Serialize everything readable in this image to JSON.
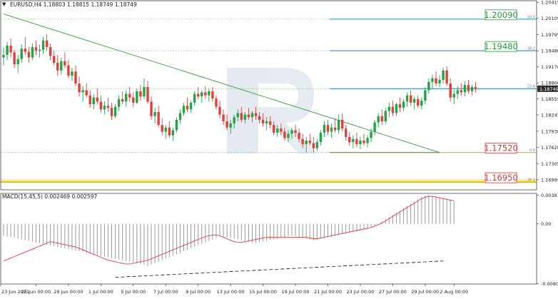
{
  "header": {
    "arrow": "▼",
    "main_label": "EURUSD,H4  1.18803 1.18815 1.18749 1.18749",
    "macd_label": "MACD(15,45,5) 0.002469 0.002597"
  },
  "colors": {
    "bull": "#22a447",
    "bear": "#e1403a",
    "trend": "#3c9a3c",
    "fibo": "#35a4b3",
    "fibo_low": "#e0c020",
    "grid": "#7fbf7f",
    "macd_hist": "#9a9a9a",
    "macd_signal": "#e04040",
    "price_tag_bg": "#2d2d2d"
  },
  "chart_data": [
    {
      "type": "candlestick",
      "title": "EURUSD,H4",
      "ohlc_header": "1.18803 1.18815 1.18749 1.18749",
      "x_ticks": [
        "23 Jun 2021",
        "25 Jun 00:00",
        "29 Jun 00:00",
        "1 Jul 00:00",
        "5 Jul 00:00",
        "7 Jul 00:00",
        "9 Jul 00:00",
        "13 Jul 00:00",
        "15 Jul 00:00",
        "19 Jul 00:00",
        "21 Jul 00:00",
        "23 Jul 00:00",
        "27 Jul 00:00",
        "29 Jul 00:00",
        "2 Aug 00:00"
      ],
      "y_ticks": [
        1.20415,
        1.20105,
        1.19795,
        1.1948,
        1.1917,
        1.1886,
        1.18555,
        1.18245,
        1.1793,
        1.1762,
        1.17305,
        1.16995
      ],
      "ylim": [
        1.168,
        1.20445
      ],
      "current_price": "1.18749",
      "current_price_value": 1.18749,
      "fibonacci_levels": [
        {
          "ratio": "50.0",
          "value": 1.2009,
          "label": "1.20090",
          "box": true,
          "color": "fibo"
        },
        {
          "ratio": "38.2",
          "value": 1.1948,
          "label": "1.19480",
          "box": true,
          "color": "fibo"
        },
        {
          "ratio": "23.6",
          "value": 1.1875,
          "label": "",
          "box": false,
          "color": "fibo"
        },
        {
          "ratio": "0.0",
          "value": 1.1752,
          "label": "1.17520",
          "box": true,
          "color": "fibo_low"
        },
        {
          "ratio": "38.2",
          "value": 1.1695,
          "label": "1.16950",
          "box": true,
          "color": "fibo_low"
        }
      ],
      "trendline": {
        "start": [
          0,
          1.2019
        ],
        "end": [
          121,
          1.1752
        ]
      },
      "candles": [
        [
          1.1935,
          1.1955,
          1.192,
          1.194
        ],
        [
          1.194,
          1.1965,
          1.193,
          1.1958
        ],
        [
          1.1958,
          1.1972,
          1.1935,
          1.1945
        ],
        [
          1.1945,
          1.195,
          1.1915,
          1.1922
        ],
        [
          1.1922,
          1.194,
          1.1905,
          1.1932
        ],
        [
          1.1932,
          1.196,
          1.1925,
          1.1952
        ],
        [
          1.1952,
          1.1975,
          1.194,
          1.1946
        ],
        [
          1.1946,
          1.1955,
          1.1925,
          1.1935
        ],
        [
          1.1935,
          1.1962,
          1.193,
          1.1955
        ],
        [
          1.1955,
          1.1968,
          1.194,
          1.1948
        ],
        [
          1.1948,
          1.196,
          1.1935,
          1.195
        ],
        [
          1.195,
          1.1975,
          1.1942,
          1.1968
        ],
        [
          1.1968,
          1.198,
          1.1948,
          1.1955
        ],
        [
          1.1955,
          1.1962,
          1.193,
          1.1938
        ],
        [
          1.1938,
          1.1948,
          1.192,
          1.1925
        ],
        [
          1.1925,
          1.194,
          1.19,
          1.191
        ],
        [
          1.191,
          1.1935,
          1.1902,
          1.1928
        ],
        [
          1.1928,
          1.1945,
          1.1915,
          1.192
        ],
        [
          1.192,
          1.193,
          1.1895,
          1.19
        ],
        [
          1.19,
          1.1915,
          1.189,
          1.1908
        ],
        [
          1.1908,
          1.192,
          1.188,
          1.1885
        ],
        [
          1.1885,
          1.1898,
          1.186,
          1.1868
        ],
        [
          1.1868,
          1.188,
          1.185,
          1.1872
        ],
        [
          1.1872,
          1.1885,
          1.1858,
          1.1862
        ],
        [
          1.1862,
          1.1872,
          1.1838,
          1.1845
        ],
        [
          1.1845,
          1.1865,
          1.1835,
          1.1858
        ],
        [
          1.1858,
          1.1875,
          1.1845,
          1.185
        ],
        [
          1.185,
          1.1862,
          1.1828,
          1.1835
        ],
        [
          1.1835,
          1.185,
          1.1825,
          1.1842
        ],
        [
          1.1842,
          1.1858,
          1.183,
          1.1838
        ],
        [
          1.1838,
          1.1848,
          1.1815,
          1.1822
        ],
        [
          1.1822,
          1.1845,
          1.1818,
          1.184
        ],
        [
          1.184,
          1.1862,
          1.1832,
          1.1855
        ],
        [
          1.1855,
          1.187,
          1.1845,
          1.185
        ],
        [
          1.185,
          1.1872,
          1.184,
          1.1865
        ],
        [
          1.1865,
          1.1878,
          1.185,
          1.1858
        ],
        [
          1.1858,
          1.1868,
          1.184,
          1.1848
        ],
        [
          1.1848,
          1.1875,
          1.1845,
          1.187
        ],
        [
          1.187,
          1.1882,
          1.1852,
          1.186
        ],
        [
          1.186,
          1.1895,
          1.1855,
          1.1878
        ],
        [
          1.1878,
          1.189,
          1.1845,
          1.185
        ],
        [
          1.185,
          1.186,
          1.1815,
          1.1822
        ],
        [
          1.1822,
          1.1838,
          1.1808,
          1.183
        ],
        [
          1.183,
          1.1842,
          1.18,
          1.1805
        ],
        [
          1.1805,
          1.1818,
          1.1785,
          1.1792
        ],
        [
          1.1792,
          1.1805,
          1.1778,
          1.18
        ],
        [
          1.18,
          1.1812,
          1.178,
          1.1785
        ],
        [
          1.1785,
          1.18,
          1.1775,
          1.1795
        ],
        [
          1.1795,
          1.182,
          1.179,
          1.1815
        ],
        [
          1.1815,
          1.1835,
          1.1808,
          1.1828
        ],
        [
          1.1828,
          1.1848,
          1.1822,
          1.1842
        ],
        [
          1.1842,
          1.1858,
          1.183,
          1.1835
        ],
        [
          1.1835,
          1.1852,
          1.1828,
          1.1848
        ],
        [
          1.1848,
          1.187,
          1.1842,
          1.1865
        ],
        [
          1.1865,
          1.1878,
          1.1855,
          1.186
        ],
        [
          1.186,
          1.1872,
          1.1848,
          1.1868
        ],
        [
          1.1868,
          1.188,
          1.1855,
          1.1862
        ],
        [
          1.1862,
          1.1875,
          1.185,
          1.187
        ],
        [
          1.187,
          1.1878,
          1.185,
          1.1856
        ],
        [
          1.1856,
          1.1862,
          1.1835,
          1.184
        ],
        [
          1.184,
          1.1852,
          1.1818,
          1.1825
        ],
        [
          1.1825,
          1.1835,
          1.1805,
          1.1812
        ],
        [
          1.1812,
          1.1825,
          1.1795,
          1.18
        ],
        [
          1.18,
          1.1815,
          1.1788,
          1.1808
        ],
        [
          1.1808,
          1.1825,
          1.1798,
          1.182
        ],
        [
          1.182,
          1.1835,
          1.1812,
          1.1828
        ],
        [
          1.1828,
          1.184,
          1.181,
          1.1815
        ],
        [
          1.1815,
          1.183,
          1.1808,
          1.1825
        ],
        [
          1.1825,
          1.1838,
          1.1815,
          1.182
        ],
        [
          1.182,
          1.1832,
          1.181,
          1.1828
        ],
        [
          1.1828,
          1.184,
          1.1815,
          1.1822
        ],
        [
          1.1822,
          1.183,
          1.1808,
          1.1815
        ],
        [
          1.1815,
          1.1828,
          1.1802,
          1.1808
        ],
        [
          1.1808,
          1.182,
          1.1795,
          1.1812
        ],
        [
          1.1812,
          1.1822,
          1.1798,
          1.1805
        ],
        [
          1.1805,
          1.1812,
          1.1785,
          1.179
        ],
        [
          1.179,
          1.1805,
          1.1782,
          1.1798
        ],
        [
          1.1798,
          1.1808,
          1.1785,
          1.1792
        ],
        [
          1.1792,
          1.18,
          1.1775,
          1.178
        ],
        [
          1.178,
          1.1795,
          1.1772,
          1.1788
        ],
        [
          1.1788,
          1.18,
          1.1778,
          1.1795
        ],
        [
          1.1795,
          1.1805,
          1.1782,
          1.179
        ],
        [
          1.179,
          1.1798,
          1.1772,
          1.1778
        ],
        [
          1.1778,
          1.1788,
          1.176,
          1.1768
        ],
        [
          1.1768,
          1.1782,
          1.1752,
          1.1775
        ],
        [
          1.1775,
          1.1788,
          1.1765,
          1.177
        ],
        [
          1.177,
          1.1782,
          1.1752,
          1.176
        ],
        [
          1.176,
          1.1778,
          1.1755,
          1.1772
        ],
        [
          1.1772,
          1.1795,
          1.1765,
          1.179
        ],
        [
          1.179,
          1.1812,
          1.1782,
          1.1805
        ],
        [
          1.1805,
          1.1815,
          1.1785,
          1.1792
        ],
        [
          1.1792,
          1.1808,
          1.178,
          1.18
        ],
        [
          1.18,
          1.1818,
          1.179,
          1.1795
        ],
        [
          1.1795,
          1.1825,
          1.1788,
          1.1815
        ],
        [
          1.1815,
          1.1828,
          1.1792,
          1.1798
        ],
        [
          1.1798,
          1.1805,
          1.1775,
          1.1782
        ],
        [
          1.1782,
          1.1792,
          1.1765,
          1.1772
        ],
        [
          1.1772,
          1.1785,
          1.176,
          1.1778
        ],
        [
          1.1778,
          1.179,
          1.1762,
          1.1768
        ],
        [
          1.1768,
          1.1782,
          1.1758,
          1.1775
        ],
        [
          1.1775,
          1.1788,
          1.1765,
          1.177
        ],
        [
          1.177,
          1.1785,
          1.1762,
          1.178
        ],
        [
          1.178,
          1.1798,
          1.1772,
          1.1792
        ],
        [
          1.1792,
          1.1815,
          1.1785,
          1.181
        ],
        [
          1.181,
          1.1828,
          1.18,
          1.1822
        ],
        [
          1.1822,
          1.1835,
          1.1805,
          1.1812
        ],
        [
          1.1812,
          1.1838,
          1.1808,
          1.1832
        ],
        [
          1.1832,
          1.1848,
          1.182,
          1.184
        ],
        [
          1.184,
          1.1852,
          1.1822,
          1.1828
        ],
        [
          1.1828,
          1.1848,
          1.1822,
          1.1845
        ],
        [
          1.1845,
          1.1858,
          1.183,
          1.1838
        ],
        [
          1.1838,
          1.1855,
          1.1832,
          1.185
        ],
        [
          1.185,
          1.1868,
          1.184,
          1.1862
        ],
        [
          1.1862,
          1.1872,
          1.1842,
          1.1848
        ],
        [
          1.1848,
          1.186,
          1.1835,
          1.1855
        ],
        [
          1.1855,
          1.1862,
          1.1838,
          1.1842
        ],
        [
          1.1842,
          1.1858,
          1.1835,
          1.1852
        ],
        [
          1.1852,
          1.1878,
          1.1845,
          1.1872
        ],
        [
          1.1872,
          1.1895,
          1.1865,
          1.1888
        ],
        [
          1.1888,
          1.1902,
          1.1875,
          1.1895
        ],
        [
          1.1895,
          1.1908,
          1.188,
          1.1885
        ],
        [
          1.1885,
          1.19,
          1.1878,
          1.1892
        ],
        [
          1.1892,
          1.1915,
          1.1885,
          1.191
        ],
        [
          1.191,
          1.1918,
          1.188,
          1.1885
        ],
        [
          1.1885,
          1.1895,
          1.185,
          1.1858
        ],
        [
          1.1858,
          1.1872,
          1.1845,
          1.1865
        ],
        [
          1.1865,
          1.188,
          1.1855,
          1.1872
        ],
        [
          1.1872,
          1.1885,
          1.1862,
          1.1868
        ],
        [
          1.1868,
          1.189,
          1.186,
          1.1882
        ],
        [
          1.1882,
          1.1892,
          1.1865,
          1.187
        ],
        [
          1.187,
          1.1882,
          1.1862,
          1.1878
        ],
        [
          1.1878,
          1.1888,
          1.1868,
          1.1875
        ]
      ]
    },
    {
      "type": "bar",
      "title": "MACD(15,45,5) 0.002469 0.002597",
      "y_ticks": [
        0.003873,
        0.0,
        -0.008051
      ],
      "y_tick_labels": [
        "0.003873",
        "0.00",
        "-0.008051"
      ],
      "ylim": [
        -0.0081,
        0.0041
      ],
      "histogram": [
        -0.0016,
        -0.0017,
        -0.0018,
        -0.0019,
        -0.002,
        -0.0021,
        -0.0022,
        -0.0023,
        -0.0024,
        -0.0025,
        -0.0026,
        -0.0027,
        -0.0028,
        -0.0029,
        -0.003,
        -0.0031,
        -0.0032,
        -0.0033,
        -0.0034,
        -0.0035,
        -0.0036,
        -0.0037,
        -0.0038,
        -0.0039,
        -0.004,
        -0.0041,
        -0.0042,
        -0.0043,
        -0.0044,
        -0.0045,
        -0.0046,
        -0.0047,
        -0.0048,
        -0.0049,
        -0.005,
        -0.0051,
        -0.0052,
        -0.0053,
        -0.0054,
        -0.0055,
        -0.0057,
        -0.0055,
        -0.0053,
        -0.0051,
        -0.0049,
        -0.0047,
        -0.0045,
        -0.0043,
        -0.0041,
        -0.0039,
        -0.0037,
        -0.0035,
        -0.0033,
        -0.0031,
        -0.0029,
        -0.0027,
        -0.0025,
        -0.0023,
        -0.0021,
        -0.0019,
        -0.0017,
        -0.0017,
        -0.0018,
        -0.0019,
        -0.002,
        -0.0021,
        -0.0022,
        -0.0023,
        -0.0024,
        -0.0025,
        -0.0026,
        -0.0025,
        -0.0024,
        -0.0023,
        -0.0022,
        -0.0021,
        -0.002,
        -0.0019,
        -0.0018,
        -0.0017,
        -0.0016,
        -0.0017,
        -0.0018,
        -0.0019,
        -0.002,
        -0.0021,
        -0.0022,
        -0.0021,
        -0.002,
        -0.0019,
        -0.0018,
        -0.0017,
        -0.0016,
        -0.0015,
        -0.0014,
        -0.0013,
        -0.0012,
        -0.0011,
        -0.001,
        -0.0009,
        -0.0008,
        -0.0006,
        -0.0004,
        -0.0002,
        0.0,
        0.0003,
        0.0006,
        0.0009,
        0.0012,
        0.0015,
        0.0018,
        0.0021,
        0.0024,
        0.0027,
        0.003,
        0.0033,
        0.0036,
        0.0038,
        0.0039,
        0.0038,
        0.0037,
        0.0036,
        0.0035,
        0.0034,
        0.0033,
        0.003
      ],
      "signal": [
        -0.005,
        -0.0048,
        -0.0046,
        -0.0044,
        -0.0042,
        -0.004,
        -0.0038,
        -0.0036,
        -0.0034,
        -0.0032,
        -0.003,
        -0.0028,
        -0.0026,
        -0.0024,
        -0.0025,
        -0.0026,
        -0.0027,
        -0.0028,
        -0.0029,
        -0.003,
        -0.0031,
        -0.0033,
        -0.0035,
        -0.0037,
        -0.0039,
        -0.0041,
        -0.0043,
        -0.0045,
        -0.0047,
        -0.0049,
        -0.005,
        -0.0051,
        -0.0052,
        -0.0053,
        -0.0054,
        -0.0054,
        -0.0053,
        -0.0052,
        -0.0051,
        -0.005,
        -0.0049,
        -0.0047,
        -0.0045,
        -0.0043,
        -0.0041,
        -0.0039,
        -0.0037,
        -0.0035,
        -0.0033,
        -0.0031,
        -0.0029,
        -0.0027,
        -0.0025,
        -0.0023,
        -0.0021,
        -0.0019,
        -0.0017,
        -0.0016,
        -0.0015,
        -0.0015,
        -0.0016,
        -0.0018,
        -0.002,
        -0.0022,
        -0.0024,
        -0.0025,
        -0.0025,
        -0.0024,
        -0.0023,
        -0.0022,
        -0.0021,
        -0.002,
        -0.0019,
        -0.0018,
        -0.0018,
        -0.0018,
        -0.0018,
        -0.0018,
        -0.0018,
        -0.0018,
        -0.0018,
        -0.0018,
        -0.0018,
        -0.0018,
        -0.0018,
        -0.0019,
        -0.002,
        -0.002,
        -0.0019,
        -0.0018,
        -0.0017,
        -0.0016,
        -0.0015,
        -0.0014,
        -0.0013,
        -0.0012,
        -0.0011,
        -0.001,
        -0.0009,
        -0.0008,
        -0.0007,
        -0.0006,
        -0.0005,
        -0.0003,
        -0.0001,
        0.0001,
        0.0004,
        0.0007,
        0.001,
        0.0013,
        0.0016,
        0.0019,
        0.0022,
        0.0025,
        0.0028,
        0.0031,
        0.0034,
        0.0036,
        0.0037,
        0.0037,
        0.0036,
        0.0035,
        0.0034,
        0.0033,
        0.0032,
        0.0031
      ],
      "divergence_line": {
        "start": [
          31,
          -0.0072
        ],
        "end": [
          122,
          -0.005
        ]
      }
    }
  ]
}
